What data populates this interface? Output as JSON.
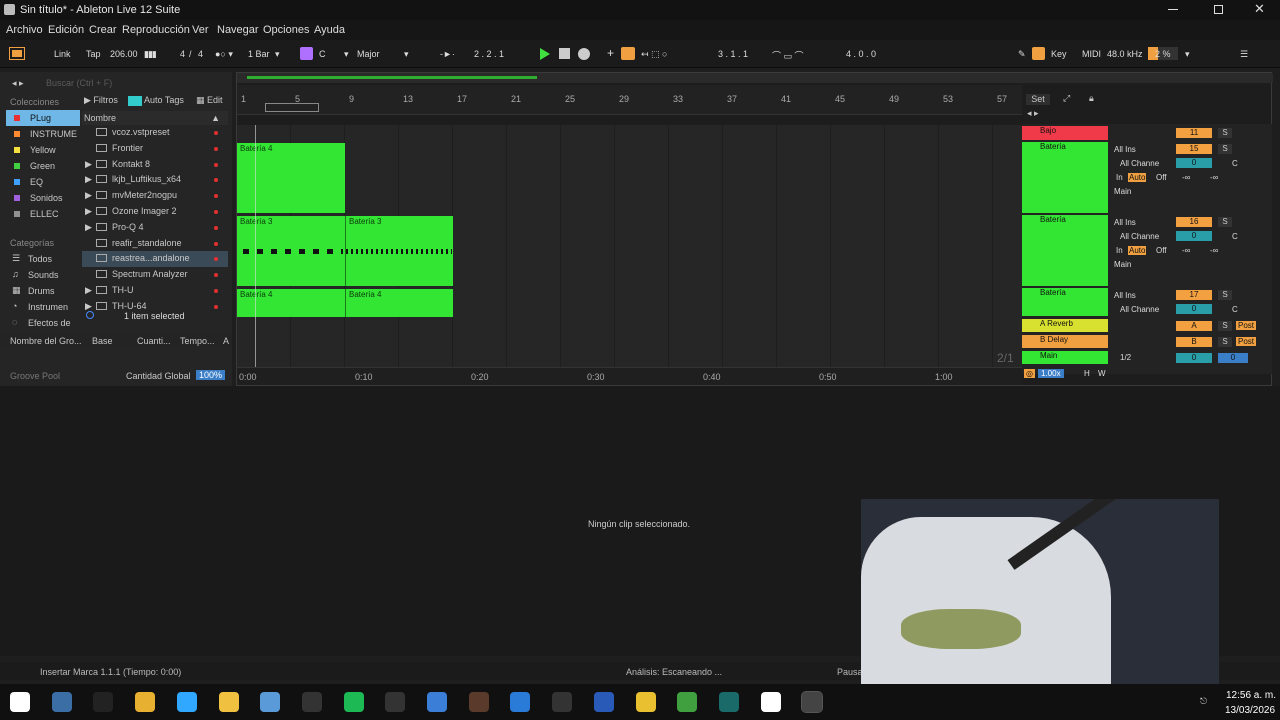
{
  "window": {
    "title": "Sin título* - Ableton Live 12 Suite"
  },
  "menu": [
    "Archivo",
    "Edición",
    "Crear",
    "Reproducción",
    "Ver",
    "Navegar",
    "Opciones",
    "Ayuda"
  ],
  "transport": {
    "link": "Link",
    "tap": "Tap",
    "tempo": "206.00",
    "signature_num": "4",
    "signature_den": "4",
    "quantize": "1 Bar",
    "key": "C",
    "scale": "Major",
    "position": "2 . 2 . 1",
    "loop_start": "3 . 1 . 1",
    "loop_length": "4 . 0 . 0",
    "key_label": "Key",
    "midi_label": "MIDI",
    "sample_rate": "48.0 kHz",
    "cpu": "2 %"
  },
  "browser": {
    "search_placeholder": "Buscar (Ctrl + F)",
    "collections_label": "Colecciones",
    "filters_label": "Filtros",
    "autotags_label": "Auto Tags",
    "edit_label": "Edit",
    "name_header": "Nombre",
    "collections": [
      {
        "label": "PLug",
        "color": "#e83030"
      },
      {
        "label": "INSTRUME",
        "color": "#ff8a30"
      },
      {
        "label": "Yellow",
        "color": "#f5e040"
      },
      {
        "label": "Green",
        "color": "#40d040"
      },
      {
        "label": "EQ",
        "color": "#40a0ff"
      },
      {
        "label": "Sonidos",
        "color": "#a060e0"
      },
      {
        "label": "ELLEC",
        "color": "#909090"
      }
    ],
    "categories_label": "Categorías",
    "categories": [
      "Todos",
      "Sounds",
      "Drums",
      "Instrumen",
      "Efectos de"
    ],
    "items": [
      "vcoz.vstpreset",
      "Frontier",
      "Kontakt 8",
      "lkjb_Luftikus_x64",
      "mvMeter2nogpu",
      "Ozone Imager 2",
      "Pro-Q 4",
      "reafir_standalone",
      "reastrea...andalone",
      "Spectrum Analyzer",
      "TH-U",
      "TH-U-64"
    ],
    "selection": "1 item selected",
    "groove_cols": [
      "Nombre del Gro...",
      "Base",
      "Cuanti...",
      "Tempo...",
      "A"
    ],
    "groove_pool": "Groove Pool",
    "global_amount_label": "Cantidad Global",
    "global_amount": "100%"
  },
  "arrangement": {
    "bars": [
      "1",
      "5",
      "9",
      "13",
      "17",
      "21",
      "25",
      "29",
      "33",
      "37",
      "41",
      "45",
      "49",
      "53",
      "57"
    ],
    "times": [
      "0:00",
      "0:10",
      "0:20",
      "0:30",
      "0:40",
      "0:50",
      "1:00"
    ],
    "set_label": "Set",
    "page": "2/1"
  },
  "clips": [
    {
      "name": "Batería 4"
    },
    {
      "name": "Batería 3"
    },
    {
      "name": "Batería 3"
    },
    {
      "name": "Batería 4"
    },
    {
      "name": "Batería 4"
    }
  ],
  "tracks": [
    {
      "name": "Bajo",
      "color": "#f03a4a",
      "num": "11",
      "input": "",
      "ch": "",
      "vol": "",
      "pan": ""
    },
    {
      "name": "Batería",
      "color": "#33e633",
      "num": "15",
      "input": "All Ins",
      "ch": "All Channe",
      "vol": "0",
      "pan": "C",
      "in": "In",
      "auto": "Auto",
      "off": "Off",
      "out": "Main",
      "m1": "-∞",
      "m2": "-∞"
    },
    {
      "name": "Batería",
      "color": "#33e633",
      "num": "16",
      "input": "All Ins",
      "ch": "All Channe",
      "vol": "0",
      "pan": "C",
      "in": "In",
      "auto": "Auto",
      "off": "Off",
      "out": "Main",
      "m1": "-∞",
      "m2": "-∞"
    },
    {
      "name": "Batería",
      "color": "#33e633",
      "num": "17",
      "input": "All Ins",
      "ch": "All Channe",
      "vol": "0",
      "pan": "C"
    },
    {
      "name": "A Reverb",
      "color": "#d8e030",
      "num": "A",
      "post": "Post"
    },
    {
      "name": "B Delay",
      "color": "#f0a040",
      "num": "B",
      "post": "Post"
    },
    {
      "name": "Main",
      "color": "#33e633",
      "num": "1/2",
      "vol": "0",
      "pan": "0"
    }
  ],
  "solo_label": "S",
  "mixer_bottom": {
    "zoom": "1.00x",
    "h": "H",
    "w": "W"
  },
  "detail": {
    "empty": "Ningún clip seleccionado."
  },
  "status": {
    "left": "Insertar Marca 1.1.1 (Tiempo: 0:00)",
    "center": "Análisis: Escaneando ...",
    "right": "Pausa"
  },
  "clock": {
    "time": "12:56 a. m.",
    "date": "13/03/2026"
  },
  "taskbar": [
    "start",
    "explorer",
    "tm",
    "chrome",
    "photoshop",
    "files",
    "notes",
    "obs",
    "spotify",
    "pdf",
    "bitwarden",
    "davinci",
    "vscode",
    "live",
    "word",
    "sticky",
    "maps",
    "terminal",
    "capcut",
    "ableton"
  ]
}
